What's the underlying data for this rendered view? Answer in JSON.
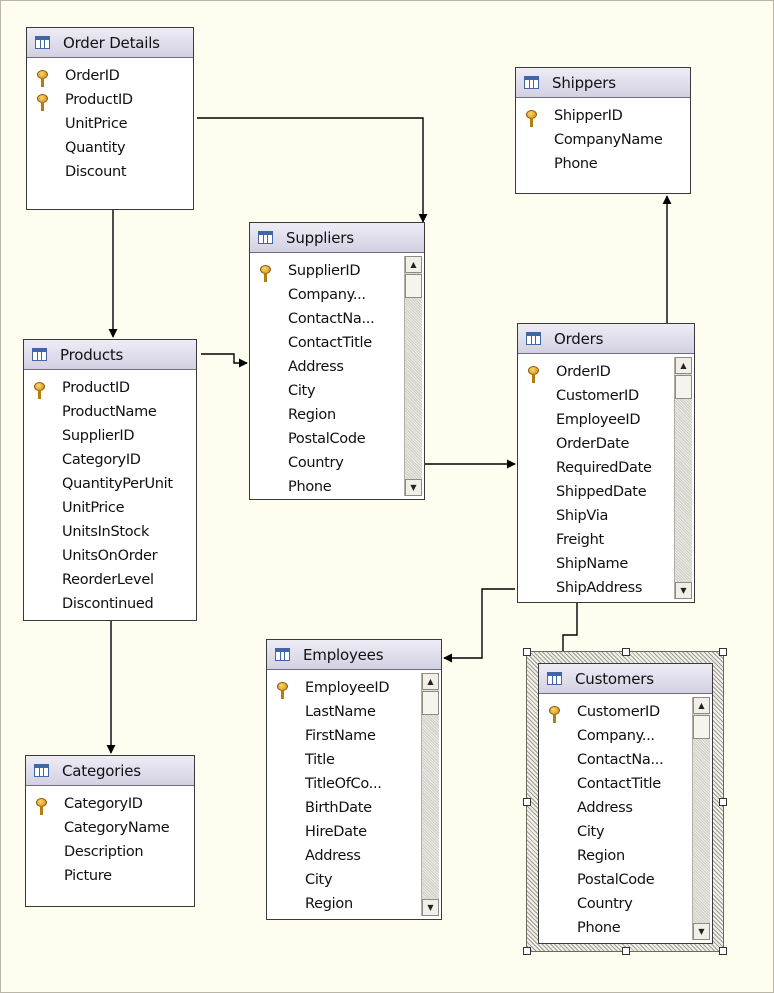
{
  "diagram": {
    "tables": [
      {
        "id": "order_details",
        "title": "Order Details",
        "keys": [
          0,
          1
        ],
        "scroll": false,
        "columns": [
          "OrderID",
          "ProductID",
          "UnitPrice",
          "Quantity",
          "Discount"
        ]
      },
      {
        "id": "shippers",
        "title": "Shippers",
        "keys": [
          0
        ],
        "scroll": false,
        "columns": [
          "ShipperID",
          "CompanyName",
          "Phone"
        ]
      },
      {
        "id": "suppliers",
        "title": "Suppliers",
        "keys": [
          0
        ],
        "scroll": true,
        "columns": [
          "SupplierID",
          "Company...",
          "ContactNa...",
          "ContactTitle",
          "Address",
          "City",
          "Region",
          "PostalCode",
          "Country",
          "Phone"
        ]
      },
      {
        "id": "products",
        "title": "Products",
        "keys": [
          0
        ],
        "scroll": false,
        "columns": [
          "ProductID",
          "ProductName",
          "SupplierID",
          "CategoryID",
          "QuantityPerUnit",
          "UnitPrice",
          "UnitsInStock",
          "UnitsOnOrder",
          "ReorderLevel",
          "Discontinued"
        ]
      },
      {
        "id": "orders",
        "title": "Orders",
        "keys": [
          0
        ],
        "scroll": true,
        "columns": [
          "OrderID",
          "CustomerID",
          "EmployeeID",
          "OrderDate",
          "RequiredDate",
          "ShippedDate",
          "ShipVia",
          "Freight",
          "ShipName",
          "ShipAddress"
        ]
      },
      {
        "id": "employees",
        "title": "Employees",
        "keys": [
          0
        ],
        "scroll": true,
        "columns": [
          "EmployeeID",
          "LastName",
          "FirstName",
          "Title",
          "TitleOfCo...",
          "BirthDate",
          "HireDate",
          "Address",
          "City",
          "Region"
        ]
      },
      {
        "id": "categories",
        "title": "Categories",
        "keys": [
          0
        ],
        "scroll": false,
        "columns": [
          "CategoryID",
          "CategoryName",
          "Description",
          "Picture"
        ]
      },
      {
        "id": "customers",
        "title": "Customers",
        "keys": [
          0
        ],
        "scroll": true,
        "selected": true,
        "columns": [
          "CustomerID",
          "Company...",
          "ContactNa...",
          "ContactTitle",
          "Address",
          "City",
          "Region",
          "PostalCode",
          "Country",
          "Phone"
        ]
      }
    ],
    "relationships": [
      {
        "from": "order_details",
        "to": "products"
      },
      {
        "from": "order_details",
        "to": "suppliers"
      },
      {
        "from": "products",
        "to": "suppliers"
      },
      {
        "from": "products",
        "to": "categories"
      },
      {
        "from": "suppliers",
        "to": "orders"
      },
      {
        "from": "orders",
        "to": "shippers"
      },
      {
        "from": "orders",
        "to": "employees"
      },
      {
        "from": "orders",
        "to": "customers"
      }
    ],
    "colors": {
      "canvas": "#fffcf0",
      "table_header": "#d3d0e2",
      "table_icon": "#4066a8",
      "key_icon": "#d9a021",
      "connector": "#000000"
    }
  }
}
